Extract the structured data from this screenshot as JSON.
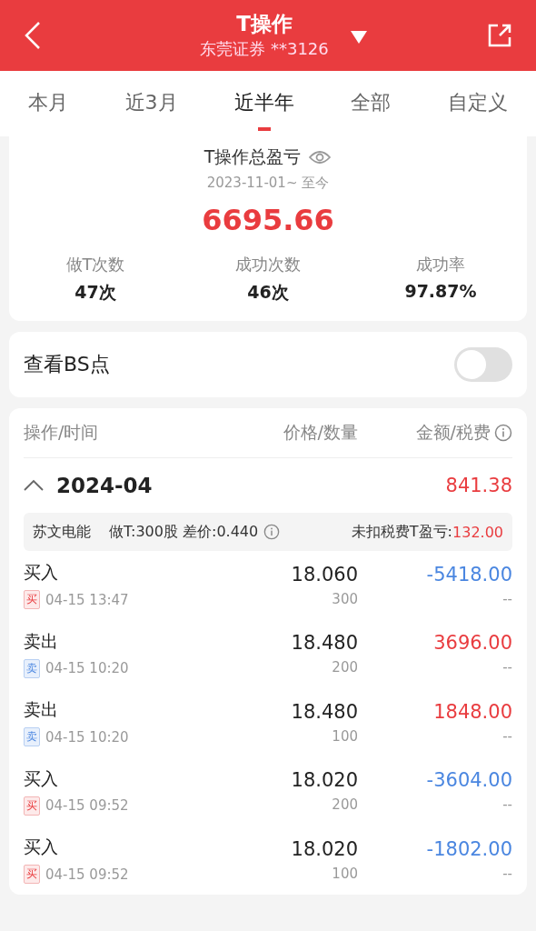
{
  "header": {
    "title": "T操作",
    "subtitle": "东莞证券 **3126"
  },
  "tabs": [
    {
      "label": "本月",
      "selected": false
    },
    {
      "label": "近3月",
      "selected": false
    },
    {
      "label": "近半年",
      "selected": true
    },
    {
      "label": "全部",
      "selected": false
    },
    {
      "label": "自定义",
      "selected": false
    }
  ],
  "summary": {
    "title": "T操作总盈亏",
    "period": "2023-11-01~ 至今",
    "total": "6695.66",
    "stats": [
      {
        "label": "做T次数",
        "value": "47次"
      },
      {
        "label": "成功次数",
        "value": "46次"
      },
      {
        "label": "成功率",
        "value": "97.87%"
      }
    ]
  },
  "bs_toggle": {
    "label": "查看BS点",
    "on": false
  },
  "table": {
    "columns": [
      "操作/时间",
      "价格/数量",
      "金额/税费"
    ],
    "groups": [
      {
        "month": "2024-04",
        "total": "841.38",
        "expanded": true,
        "stock": {
          "name": "苏文电能",
          "detail": "做T:300股 差价:0.440",
          "pnl_label": "未扣税费T盈亏:",
          "pnl_value": "132.00"
        },
        "trades": [
          {
            "kind": "buy",
            "action": "买入",
            "badge": "买",
            "time": "04-15 13:47",
            "price": "18.060",
            "qty": "300",
            "amount": "-5418.00",
            "fee": "--"
          },
          {
            "kind": "sell",
            "action": "卖出",
            "badge": "卖",
            "time": "04-15 10:20",
            "price": "18.480",
            "qty": "200",
            "amount": "3696.00",
            "fee": "--"
          },
          {
            "kind": "sell",
            "action": "卖出",
            "badge": "卖",
            "time": "04-15 10:20",
            "price": "18.480",
            "qty": "100",
            "amount": "1848.00",
            "fee": "--"
          },
          {
            "kind": "buy",
            "action": "买入",
            "badge": "买",
            "time": "04-15 09:52",
            "price": "18.020",
            "qty": "200",
            "amount": "-3604.00",
            "fee": "--"
          },
          {
            "kind": "buy",
            "action": "买入",
            "badge": "买",
            "time": "04-15 09:52",
            "price": "18.020",
            "qty": "100",
            "amount": "-1802.00",
            "fee": "--"
          }
        ]
      }
    ]
  }
}
